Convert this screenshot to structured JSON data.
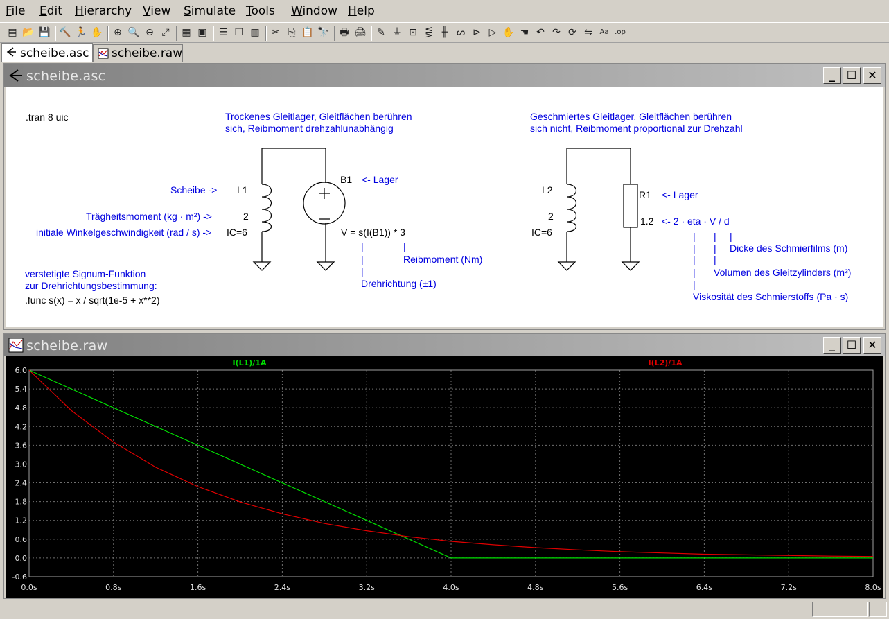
{
  "menu": [
    {
      "label": "File",
      "ul": "F",
      "rest": "ile"
    },
    {
      "label": "Edit",
      "ul": "E",
      "rest": "dit"
    },
    {
      "label": "Hierarchy",
      "ul": "H",
      "rest": "ierarchy"
    },
    {
      "label": "View",
      "ul": "V",
      "rest": "iew"
    },
    {
      "label": "Simulate",
      "ul": "S",
      "rest": "imulate"
    },
    {
      "label": "Tools",
      "ul": "T",
      "rest": "ools"
    },
    {
      "label": "Window",
      "ul": "W",
      "rest": "indow"
    },
    {
      "label": "Help",
      "ul": "H",
      "rest": "elp"
    }
  ],
  "toolbar_icons": [
    "new-schematic-icon",
    "open-icon",
    "save-icon",
    "control-panel-icon",
    "run-icon",
    "halt-icon",
    "zoom-in-icon",
    "zoom-pan-icon",
    "zoom-out-icon",
    "zoom-fit-icon",
    "plot-settings-icon",
    "autorange-icon",
    "tile-horizontal-icon",
    "cascade-icon",
    "tile-vertical-icon",
    "cut-icon",
    "copy-icon",
    "paste-icon",
    "find-icon",
    "print-preview-icon",
    "print-icon",
    "draw-wire-icon",
    "ground-icon",
    "label-net-icon",
    "resistor-icon",
    "capacitor-icon",
    "inductor-icon",
    "diode-icon",
    "component-icon",
    "move-icon",
    "drag-icon",
    "undo-icon",
    "redo-icon",
    "rotate-icon",
    "mirror-icon",
    "text-icon",
    "spice-directive-icon"
  ],
  "tabs": [
    {
      "label": "scheibe.asc"
    },
    {
      "label": "scheibe.raw"
    }
  ],
  "schematic_window": {
    "title": "scheibe.asc",
    "texts": {
      "tran": ".tran 8 uic",
      "dry_title_1": "Trockenes Gleitlager, Gleitflächen berühren",
      "dry_title_2": "sich, Reibmoment drehzahlunabhängig",
      "wet_title_1": "Geschmiertes Gleitlager, Gleitflächen berühren",
      "wet_title_2": "sich nicht, Reibmoment proportional zur Drehzahl",
      "scheibe": "Scheibe ->",
      "traegheit": "Trägheitsmoment (kg · m²) ->",
      "initiale": "initiale Winkelgeschwindigkeit (rad / s) ->",
      "l1": "L1",
      "l1_val": "2",
      "l1_ic": "IC=6",
      "b1": "B1",
      "b1_lager": "<- Lager",
      "b1_expr": "V = s(I(B1)) * 3",
      "pipe": "|",
      "reibmoment": "Reibmoment (Nm)",
      "drehrichtung": "Drehrichtung (±1)",
      "signum_1": "verstetigte Signum-Funktion",
      "signum_2": "zur Drehrichtungsbestimmung:",
      "func": ".func s(x) = x / sqrt(1e-5 + x**2)",
      "l2": "L2",
      "l2_val": "2",
      "l2_ic": "IC=6",
      "r1": "R1",
      "r1_lager": "<- Lager",
      "r1_val": "1.2",
      "r1_expr": "<- 2 · eta · V / d",
      "dicke": "Dicke des Schmierfilms (m)",
      "volumen": "Volumen des Gleitzylinders (m³)",
      "viskositaet": "Viskosität des Schmierstoffs (Pa · s)"
    }
  },
  "plot_window": {
    "title": "scheibe.raw"
  },
  "chart_data": {
    "type": "line",
    "series": [
      {
        "name": "I(L1)/1A",
        "color": "#00e000",
        "x": [
          0,
          4,
          8
        ],
        "y": [
          6,
          0,
          0
        ]
      },
      {
        "name": "I(L2)/1A",
        "color": "#e00000",
        "x": [
          0,
          0.4,
          0.8,
          1.2,
          1.6,
          2.0,
          2.4,
          2.8,
          3.2,
          3.6,
          4.0,
          4.4,
          4.8,
          5.2,
          5.6,
          6.0,
          6.4,
          6.8,
          7.2,
          7.6,
          8.0
        ],
        "y": [
          6,
          4.71,
          3.7,
          2.9,
          2.28,
          1.79,
          1.41,
          1.1,
          0.87,
          0.68,
          0.53,
          0.42,
          0.33,
          0.26,
          0.2,
          0.16,
          0.12,
          0.1,
          0.08,
          0.06,
          0.05
        ]
      }
    ],
    "xlim": [
      0,
      8
    ],
    "ylim": [
      -0.6,
      6.0
    ],
    "xticks": [
      0,
      0.8,
      1.6,
      2.4,
      3.2,
      4.0,
      4.8,
      5.6,
      6.4,
      7.2,
      8.0
    ],
    "xtick_labels": [
      "0.0s",
      "0.8s",
      "1.6s",
      "2.4s",
      "3.2s",
      "4.0s",
      "4.8s",
      "5.6s",
      "6.4s",
      "7.2s",
      "8.0s"
    ],
    "yticks": [
      6.0,
      5.4,
      4.8,
      4.2,
      3.6,
      3.0,
      2.4,
      1.8,
      1.2,
      0.6,
      0.0,
      -0.6
    ],
    "ytick_labels": [
      "6.0",
      "5.4",
      "4.8",
      "4.2",
      "3.6",
      "3.0",
      "2.4",
      "1.8",
      "1.2",
      "0.6",
      "0.0",
      "-0.6"
    ],
    "grid": true,
    "grid_color": "#707070",
    "background": "#000000"
  }
}
